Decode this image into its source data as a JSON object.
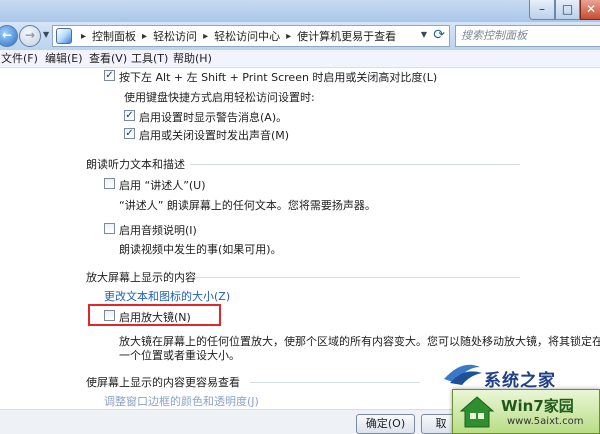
{
  "window": {
    "minimize_glyph": "–",
    "maximize_glyph": "□",
    "close_glyph": "✕"
  },
  "nav": {
    "back_glyph": "←",
    "forward_glyph": "→"
  },
  "breadcrumb": {
    "items": [
      "控制面板",
      "轻松访问",
      "轻松访问中心",
      "使计算机更易于查看"
    ],
    "separator": "▸"
  },
  "search": {
    "placeholder": "搜索控制面板"
  },
  "menubar": {
    "items": [
      "文件(F)",
      "编辑(E)",
      "查看(V)",
      "工具(T)",
      "帮助(H)"
    ]
  },
  "content": {
    "high_contrast_shortcut": "按下左 Alt + 左 Shift + Print Screen 时启用或关闭高对比度(L)",
    "shortcut_settings_label": "使用键盘快捷方式启用轻松访问设置时:",
    "show_warning": "启用设置时显示警告消息(A)。",
    "play_sound": "启用或关闭设置时发出声音(M)",
    "narrator_section": "朗读听力文本和描述",
    "enable_narrator": "启用 “讲述人”(U)",
    "narrator_desc": "“讲述人” 朗读屏幕上的任何文本。您将需要扬声器。",
    "enable_audio_desc": "启用音频说明(I)",
    "audio_desc_desc": "朗读视频中发生的事(如果可用)。",
    "magnify_section": "放大屏幕上显示的内容",
    "change_text_size_link": "更改文本和图标的大小(Z)",
    "enable_magnifier": "启用放大镜(N)",
    "magnifier_desc_line1": "放大镜在屏幕上的任何位置放大，使那个区域的所有内容变大。您可以随处移动放大镜，将其锁定在",
    "magnifier_desc_line2": "一个位置或者重设大小。",
    "easier_section": "使屏幕上显示的内容更容易查看",
    "window_border_link": "调整窗口边框的颜色和透明度(J)",
    "checked_glyph": "✓"
  },
  "buttons": {
    "ok": "确定(O)",
    "cancel": "取"
  },
  "watermark": {
    "brand": "系统之家",
    "box_title": "Win7家园",
    "box_url": "www.5aixt.com"
  },
  "colors": {
    "highlight_border": "#e2272b",
    "link": "#1c5fbf"
  }
}
